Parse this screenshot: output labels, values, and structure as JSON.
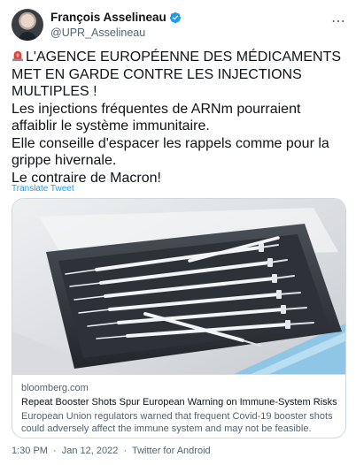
{
  "author": {
    "name": "François Asselineau",
    "handle": "@UPR_Asselineau"
  },
  "more_icon": "⋯",
  "tweet": {
    "lines": [
      "L'AGENCE EUROPÉENNE DES MÉDICAMENTS MET EN GARDE CONTRE LES INJECTIONS MULTIPLES !",
      "Les injections fréquentes de ARNm pourraient affaiblir le système immunitaire.",
      "Elle conseille d'espacer les rappels comme pour la grippe hivernale.",
      "Le contraire de Macron!"
    ],
    "translate_label": "Translate Tweet"
  },
  "card": {
    "domain": "bloomberg.com",
    "title": "Repeat Booster Shots Spur European Warning on Immune-System Risks",
    "description": "European Union regulators warned that frequent Covid-19 booster shots could adversely affect the immune system and may not be feasible."
  },
  "footer": {
    "time": "1:30 PM",
    "sep1": "·",
    "date": "Jan 12, 2022",
    "sep2": "·",
    "source": "Twitter for Android"
  },
  "colors": {
    "verified": "#1d9bf0",
    "link": "#1d9bf0",
    "secondary_text": "#536471",
    "border": "#cfd9de"
  }
}
